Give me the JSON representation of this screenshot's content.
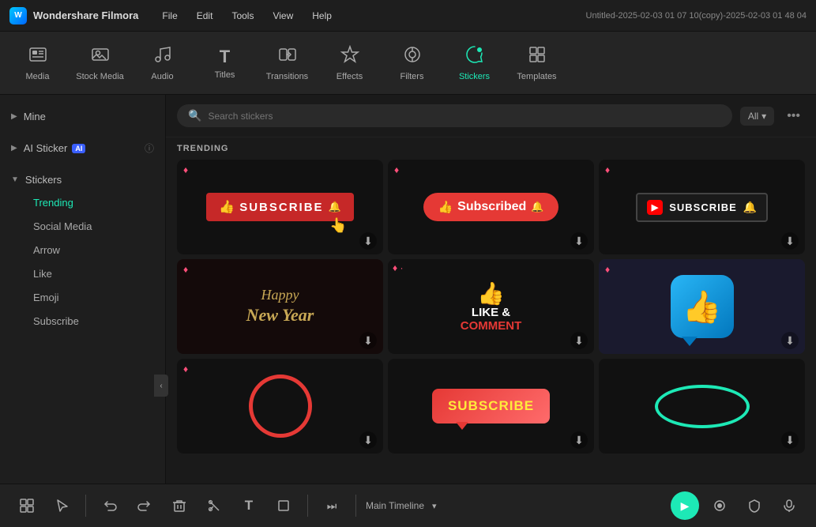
{
  "titlebar": {
    "logo_text": "W",
    "app_name": "Wondershare Filmora",
    "menu_items": [
      "File",
      "Edit",
      "Tools",
      "View",
      "Help"
    ],
    "window_title": "Untitled-2025-02-03 01 07 10(copy)-2025-02-03 01 48 04"
  },
  "toolbar": {
    "items": [
      {
        "id": "media",
        "label": "Media",
        "icon": "⬛"
      },
      {
        "id": "stock-media",
        "label": "Stock Media",
        "icon": "🖼"
      },
      {
        "id": "audio",
        "label": "Audio",
        "icon": "🎵"
      },
      {
        "id": "titles",
        "label": "Titles",
        "icon": "T"
      },
      {
        "id": "transitions",
        "label": "Transitions",
        "icon": "▶"
      },
      {
        "id": "effects",
        "label": "Effects",
        "icon": "✦"
      },
      {
        "id": "filters",
        "label": "Filters",
        "icon": "◎"
      },
      {
        "id": "stickers",
        "label": "Stickers",
        "icon": "🔗"
      },
      {
        "id": "templates",
        "label": "Templates",
        "icon": "▦"
      }
    ]
  },
  "sidebar": {
    "mine_label": "Mine",
    "ai_sticker_label": "AI Sticker",
    "stickers_label": "Stickers",
    "children": [
      {
        "id": "trending",
        "label": "Trending"
      },
      {
        "id": "social-media",
        "label": "Social Media"
      },
      {
        "id": "arrow",
        "label": "Arrow"
      },
      {
        "id": "like",
        "label": "Like"
      },
      {
        "id": "emoji",
        "label": "Emoji"
      },
      {
        "id": "subscribe",
        "label": "Subscribe"
      }
    ]
  },
  "search": {
    "placeholder": "Search stickers",
    "filter_label": "All"
  },
  "trending": {
    "section_label": "TRENDING"
  },
  "stickers": [
    {
      "id": "s1",
      "type": "subscribe-red",
      "premium": "pink"
    },
    {
      "id": "s2",
      "type": "subscribed",
      "premium": "pink",
      "text": "Subscribed"
    },
    {
      "id": "s3",
      "type": "subscribe-yt",
      "premium": "pink"
    },
    {
      "id": "s4",
      "type": "happy-newyear",
      "premium": "pink"
    },
    {
      "id": "s5",
      "type": "like-comment",
      "premium": "pink"
    },
    {
      "id": "s6",
      "type": "thumbsup",
      "premium": "pink"
    },
    {
      "id": "s7",
      "type": "circle-red",
      "premium": "pink"
    },
    {
      "id": "s8",
      "type": "subscribe-pink",
      "text": "SUBSCRIBE",
      "premium": "none"
    },
    {
      "id": "s9",
      "type": "oval-teal",
      "premium": "none"
    }
  ],
  "bottom_bar": {
    "timeline_label": "Main Timeline",
    "icons": [
      "⬛⬛",
      "↩",
      "↪",
      "🗑",
      "✂",
      "T",
      "⬜",
      "▶▶"
    ]
  }
}
